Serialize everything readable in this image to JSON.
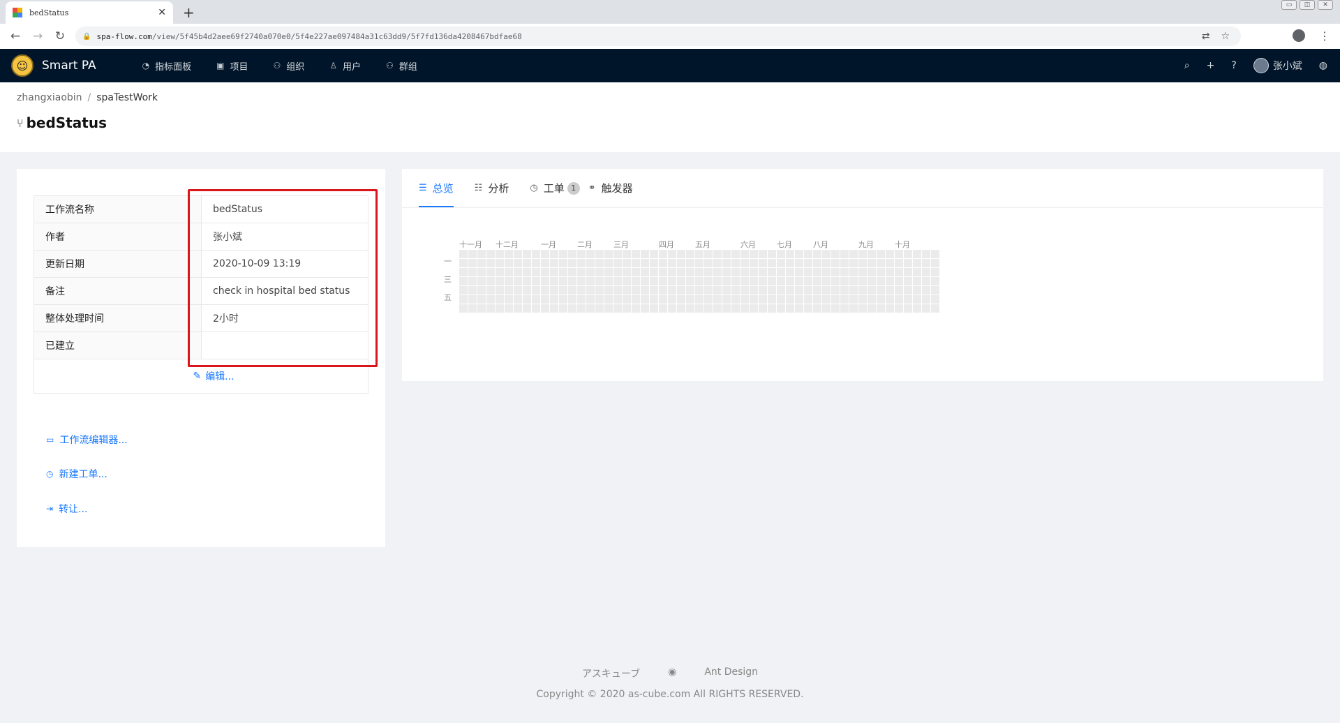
{
  "browser": {
    "tab_title": "bedStatus",
    "tab_close": "✕",
    "new_tab": "+",
    "url_host": "spa-flow.com",
    "url_path": "/view/5f45b4d2aee69f2740a070e0/5f4e227ae097484a31c63dd9/5f7fd136da4208467bdfae68",
    "window_controls": [
      "▭",
      "◫",
      "✕"
    ]
  },
  "header": {
    "brand": "Smart PA",
    "menu": [
      {
        "label": "指标面板",
        "icon": "dashboard-icon"
      },
      {
        "label": "项目",
        "icon": "project-icon"
      },
      {
        "label": "组织",
        "icon": "team-icon"
      },
      {
        "label": "用户",
        "icon": "user-icon"
      },
      {
        "label": "群组",
        "icon": "group-icon"
      }
    ],
    "user_name": "张小斌"
  },
  "breadcrumb": {
    "root": "zhangxiaobin",
    "separator": "/",
    "current": "spaTestWork"
  },
  "page_title": "bedStatus",
  "details": {
    "rows": [
      {
        "label": "工作流名称",
        "value": "bedStatus"
      },
      {
        "label": "作者",
        "value": "张小斌"
      },
      {
        "label": "更新日期",
        "value": "2020-10-09 13:19"
      },
      {
        "label": "备注",
        "value": "check in hospital bed status"
      },
      {
        "label": "整体处理时间",
        "value": "2小时"
      },
      {
        "label": "已建立",
        "value": ""
      }
    ],
    "edit_label": "编辑..."
  },
  "actions": {
    "editor": "工作流编辑器...",
    "new_ticket": "新建工单...",
    "transfer": "转让..."
  },
  "tabs": {
    "overview": "总览",
    "analysis": "分析",
    "tickets": "工单",
    "ticket_count": "1",
    "triggers": "触发器"
  },
  "heatmap": {
    "months": [
      "十一月",
      "十二月",
      "一月",
      "二月",
      "三月",
      "四月",
      "五月",
      "六月",
      "七月",
      "八月",
      "九月",
      "十月"
    ],
    "day_labels": [
      "一",
      "三",
      "五"
    ],
    "weeks": 53,
    "empty_color": "#ebebeb"
  },
  "footer": {
    "link1": "アスキューブ",
    "link2": "Ant Design",
    "copyright": "Copyright © 2020 as-cube.com All RIGHTS RESERVED."
  },
  "colors": {
    "header_bg": "#001529",
    "accent": "#1677ff",
    "highlight_border": "#d9161b"
  }
}
